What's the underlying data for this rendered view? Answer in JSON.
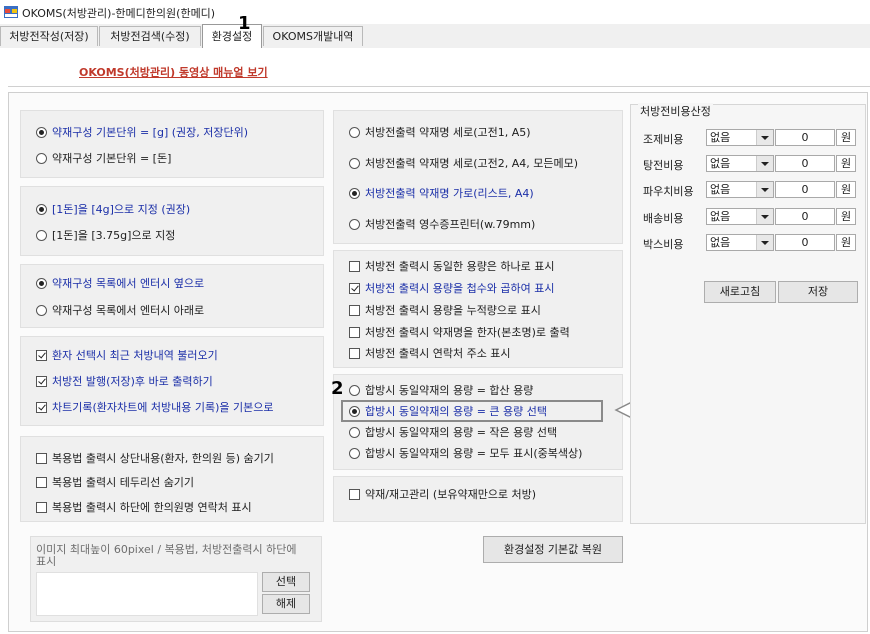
{
  "window": {
    "title": "OKOMS(처방관리)-한메디한의원(한메디)"
  },
  "tabs": [
    {
      "label": "처방전작성(저장)"
    },
    {
      "label": "처방전검색(수정)"
    },
    {
      "label": "환경설정",
      "active": true
    },
    {
      "label": "OKOMS개발내역"
    }
  ],
  "callouts": {
    "one": "1",
    "two": "2"
  },
  "manual_link": "OKOMS(처방관리) 동영상 매뉴얼 보기",
  "left": {
    "unit_group": [
      {
        "label": "약재구성 기본단위 = [g] (권장, 저장단위)",
        "selected": true
      },
      {
        "label": "약재구성 기본단위 = [돈]",
        "selected": false
      }
    ],
    "don_group": [
      {
        "label": "[1돈]을 [4g]으로 지정 (권장)",
        "selected": true
      },
      {
        "label": "[1돈]을 [3.75g]으로 지정",
        "selected": false
      }
    ],
    "enter_group": [
      {
        "label": "약재구성 목록에서 엔터시 옆으로",
        "selected": true
      },
      {
        "label": "약재구성 목록에서 엔터시 아래로",
        "selected": false
      }
    ],
    "patient_checks": [
      {
        "label": "환자 선택시 최근 처방내역 불러오기",
        "checked": true
      },
      {
        "label": "처방전 발행(저장)후 바로 출력하기",
        "checked": true
      },
      {
        "label": "차트기록(환자차트에 처방내용 기록)을 기본으로",
        "checked": true
      }
    ],
    "dosage_checks": [
      {
        "label": "복용법 출력시 상단내용(환자, 한의원 등) 숨기기",
        "checked": false
      },
      {
        "label": "복용법 출력시 테두리선 숨기기",
        "checked": false
      },
      {
        "label": "복용법 출력시 하단에 한의원명 연락처 표시",
        "checked": false
      }
    ],
    "image": {
      "caption": "이미지 최대높이 60pixel / 복용법, 처방전출력시 하단에 표시",
      "select_button": "선택",
      "clear_button": "해제"
    }
  },
  "middle": {
    "print_layout": [
      {
        "label": "처방전출력  약재명 세로(고전1, A5)",
        "selected": false
      },
      {
        "label": "처방전출력  약재명 세로(고전2, A4, 모든메모)",
        "selected": false
      },
      {
        "label": "처방전출력  약재명 가로(리스트, A4)",
        "selected": true
      },
      {
        "label": "처방전출력  영수증프린터(w.79mm)",
        "selected": false
      }
    ],
    "print_checks": [
      {
        "label": "처방전 출력시 동일한 용량은 하나로 표시",
        "checked": false
      },
      {
        "label": "처방전 출력시 용량을 첩수와 곱하여 표시",
        "checked": true
      },
      {
        "label": "처방전 출력시 용량을 누적량으로 표시",
        "checked": false
      },
      {
        "label": "처방전 출력시 약재명을 한자(본초명)로 출력",
        "checked": false
      },
      {
        "label": "처방전 출력시 연락처 주소 표시",
        "checked": false
      }
    ],
    "merge_group": [
      {
        "label": "합방시 동일약재의 용량 = 합산 용량",
        "selected": false
      },
      {
        "label": "합방시 동일약재의 용량 = 큰 용량 선택",
        "selected": true
      },
      {
        "label": "합방시 동일약재의 용량 = 작은 용량 선택",
        "selected": false
      },
      {
        "label": "합방시 동일약재의 용량 = 모두 표시(중복색상)",
        "selected": false
      }
    ],
    "stock_check": {
      "label": "약재/재고관리 (보유약재만으로 처방)",
      "checked": false
    },
    "restore_button": "환경설정 기본값 복원"
  },
  "cost": {
    "title": "처방전비용산정",
    "rows": [
      {
        "label": "조제비용",
        "option": "없음",
        "value": "0",
        "unit": "원"
      },
      {
        "label": "탕전비용",
        "option": "없음",
        "value": "0",
        "unit": "원"
      },
      {
        "label": "파우치비용",
        "option": "없음",
        "value": "0",
        "unit": "원"
      },
      {
        "label": "배송비용",
        "option": "없음",
        "value": "0",
        "unit": "원"
      },
      {
        "label": "박스비용",
        "option": "없음",
        "value": "0",
        "unit": "원"
      }
    ],
    "refresh_button": "새로고침",
    "save_button": "저장"
  },
  "colors": {
    "link": "#c0392b",
    "highlight_text": "#1b2fa8",
    "highlight_box": "#8a8a8a"
  }
}
